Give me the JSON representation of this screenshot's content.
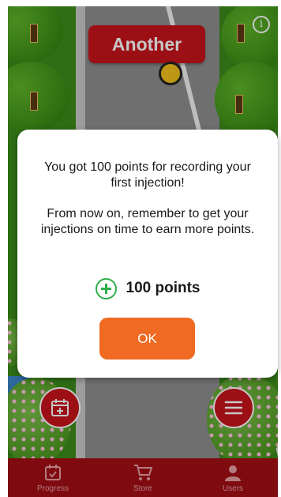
{
  "game": {
    "banner_text": "Another",
    "info_label": "i"
  },
  "modal": {
    "message_line1": "You got 100 points for recording your first injection!",
    "message_line2": "From now on, remember to get your injections on time to earn more points.",
    "points_label": "100 points",
    "ok_label": "OK"
  },
  "nav": {
    "items": [
      {
        "label": "Progress",
        "icon": "calendar-check-icon"
      },
      {
        "label": "Store",
        "icon": "shopping-cart-icon"
      },
      {
        "label": "Users",
        "icon": "user-icon"
      }
    ]
  },
  "colors": {
    "accent_red": "#c8141c",
    "ok_orange": "#f06a23",
    "plus_green": "#2fae4a"
  }
}
